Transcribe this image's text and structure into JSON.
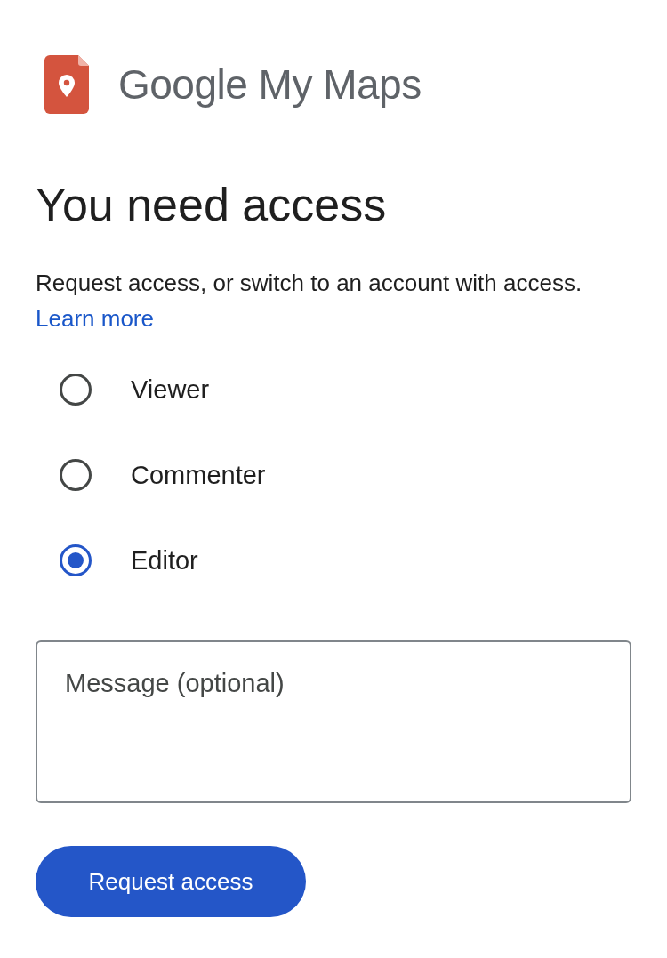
{
  "app": {
    "logo_text": "Google My Maps"
  },
  "heading": "You need access",
  "description": {
    "text": "Request access, or switch to an account with access.",
    "link": "Learn more"
  },
  "roles": [
    {
      "label": "Viewer",
      "selected": false
    },
    {
      "label": "Commenter",
      "selected": false
    },
    {
      "label": "Editor",
      "selected": true
    }
  ],
  "message": {
    "placeholder": "Message (optional)"
  },
  "submit_button": "Request access"
}
